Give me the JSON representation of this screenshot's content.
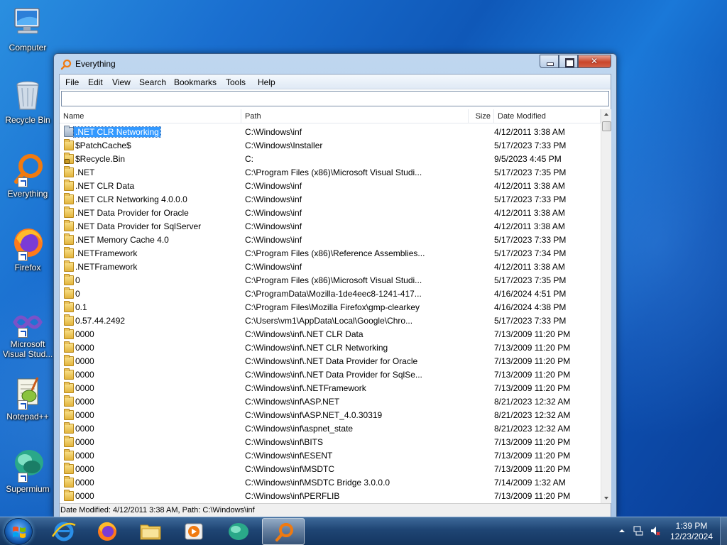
{
  "desktop": {
    "icons": [
      {
        "label": "Computer"
      },
      {
        "label": "Recycle Bin"
      },
      {
        "label": "Everything"
      },
      {
        "label": "Firefox"
      },
      {
        "label": "Microsoft Visual Stud..."
      },
      {
        "label": "Notepad++"
      },
      {
        "label": "Supermium"
      }
    ]
  },
  "window": {
    "title": "Everything",
    "menu": [
      "File",
      "Edit",
      "View",
      "Search",
      "Bookmarks",
      "Tools",
      "Help"
    ],
    "search": {
      "value": "",
      "placeholder": ""
    },
    "columns": {
      "name": "Name",
      "path": "Path",
      "size": "Size",
      "date": "Date Modified"
    },
    "rows": [
      {
        "name": ".NET CLR Networking",
        "path": "C:\\Windows\\inf",
        "date": "4/12/2011 3:38 AM",
        "selected": true
      },
      {
        "name": "$PatchCache$",
        "path": "C:\\Windows\\Installer",
        "date": "5/17/2023 7:33 PM"
      },
      {
        "name": "$Recycle.Bin",
        "path": "C:",
        "date": "9/5/2023 4:45 PM",
        "locked": true
      },
      {
        "name": ".NET",
        "path": "C:\\Program Files (x86)\\Microsoft Visual Studi...",
        "date": "5/17/2023 7:35 PM"
      },
      {
        "name": ".NET CLR Data",
        "path": "C:\\Windows\\inf",
        "date": "4/12/2011 3:38 AM"
      },
      {
        "name": ".NET CLR Networking 4.0.0.0",
        "path": "C:\\Windows\\inf",
        "date": "5/17/2023 7:33 PM"
      },
      {
        "name": ".NET Data Provider for Oracle",
        "path": "C:\\Windows\\inf",
        "date": "4/12/2011 3:38 AM"
      },
      {
        "name": ".NET Data Provider for SqlServer",
        "path": "C:\\Windows\\inf",
        "date": "4/12/2011 3:38 AM"
      },
      {
        "name": ".NET Memory Cache 4.0",
        "path": "C:\\Windows\\inf",
        "date": "5/17/2023 7:33 PM"
      },
      {
        "name": ".NETFramework",
        "path": "C:\\Program Files (x86)\\Reference Assemblies...",
        "date": "5/17/2023 7:34 PM"
      },
      {
        "name": ".NETFramework",
        "path": "C:\\Windows\\inf",
        "date": "4/12/2011 3:38 AM"
      },
      {
        "name": "0",
        "path": "C:\\Program Files (x86)\\Microsoft Visual Studi...",
        "date": "5/17/2023 7:35 PM"
      },
      {
        "name": "0",
        "path": "C:\\ProgramData\\Mozilla-1de4eec8-1241-417...",
        "date": "4/16/2024 4:51 PM"
      },
      {
        "name": "0.1",
        "path": "C:\\Program Files\\Mozilla Firefox\\gmp-clearkey",
        "date": "4/16/2024 4:38 PM"
      },
      {
        "name": "0.57.44.2492",
        "path": "C:\\Users\\vm1\\AppData\\Local\\Google\\Chro...",
        "date": "5/17/2023 7:33 PM"
      },
      {
        "name": "0000",
        "path": "C:\\Windows\\inf\\.NET CLR Data",
        "date": "7/13/2009 11:20 PM"
      },
      {
        "name": "0000",
        "path": "C:\\Windows\\inf\\.NET CLR Networking",
        "date": "7/13/2009 11:20 PM"
      },
      {
        "name": "0000",
        "path": "C:\\Windows\\inf\\.NET Data Provider for Oracle",
        "date": "7/13/2009 11:20 PM"
      },
      {
        "name": "0000",
        "path": "C:\\Windows\\inf\\.NET Data Provider for SqlSe...",
        "date": "7/13/2009 11:20 PM"
      },
      {
        "name": "0000",
        "path": "C:\\Windows\\inf\\.NETFramework",
        "date": "7/13/2009 11:20 PM"
      },
      {
        "name": "0000",
        "path": "C:\\Windows\\inf\\ASP.NET",
        "date": "8/21/2023 12:32 AM"
      },
      {
        "name": "0000",
        "path": "C:\\Windows\\inf\\ASP.NET_4.0.30319",
        "date": "8/21/2023 12:32 AM"
      },
      {
        "name": "0000",
        "path": "C:\\Windows\\inf\\aspnet_state",
        "date": "8/21/2023 12:32 AM"
      },
      {
        "name": "0000",
        "path": "C:\\Windows\\inf\\BITS",
        "date": "7/13/2009 11:20 PM"
      },
      {
        "name": "0000",
        "path": "C:\\Windows\\inf\\ESENT",
        "date": "7/13/2009 11:20 PM"
      },
      {
        "name": "0000",
        "path": "C:\\Windows\\inf\\MSDTC",
        "date": "7/13/2009 11:20 PM"
      },
      {
        "name": "0000",
        "path": "C:\\Windows\\inf\\MSDTC Bridge 3.0.0.0",
        "date": "7/14/2009 1:32 AM"
      },
      {
        "name": "0000",
        "path": "C:\\Windows\\inf\\PERFLIB",
        "date": "7/13/2009 11:20 PM"
      }
    ],
    "status": "Date Modified: 4/12/2011 3:38 AM, Path: C:\\Windows\\inf"
  },
  "taskbar": {
    "apps": [
      "internet-explorer",
      "firefox",
      "file-explorer",
      "media-player",
      "supermium",
      "everything"
    ],
    "active_app": "everything",
    "clock": {
      "time": "1:39 PM",
      "date": "12/23/2024"
    }
  }
}
